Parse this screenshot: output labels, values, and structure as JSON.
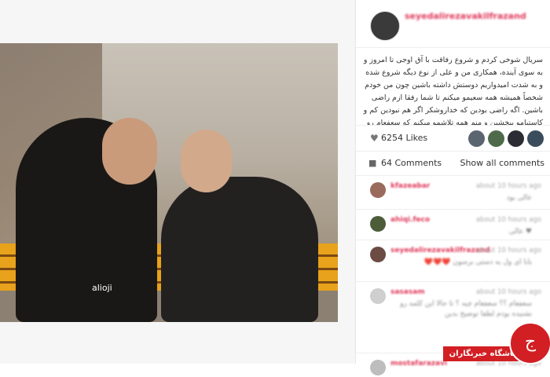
{
  "post": {
    "username": "seyedalirezavakilfrazand",
    "photo_watermark": "alioji",
    "caption": "سریال شوخی کردم و شروع رفاقت با آق اوجی تا امروز و به سوی آینده، همکاری من و علی از نوع دیگه شروع شده و به شدت امیدواریم دوستش داشته باشین چون من خودم شخصاً همیشه همه سعیمو میکنم تا شما رفقا ازم راضی باشین. اگه راضی بودین که خداروشکر اگر هم نبودین کم و کاستیامو ببخشین و منم همه تلاشمو میکنم که سعفعام رو کمتر کنم.مثل همیشه ممنون مهرتونم",
    "likes_label": "6254 Likes",
    "comments_label": "64 Comments",
    "show_all_label": "Show all comments"
  },
  "comments": [
    {
      "user": "kfazeabar",
      "time": "about 10 hours ago",
      "text": "عالی بود"
    },
    {
      "user": "ahiqi.feco",
      "time": "about 10 hours ago",
      "text": "♥ عالی"
    },
    {
      "user": "seyedalirezavakilfrazand",
      "time": "about 10 hours ago",
      "text": "بابا ای ول یه دستی برسون ❤️❤️❤️"
    },
    {
      "user": "sasasam",
      "time": "about 10 hours ago",
      "text": "سعفعام ؟؟ سعفعام چیه ؟ تا حالا این کلمه رو نشنیده بودم لطفا توضیح بدین"
    },
    {
      "user": "mostafarazavi",
      "time": "about 10 hours ago",
      "text": ""
    }
  ],
  "icons": {
    "heart": "heart-icon",
    "comment": "comment-bubble-icon"
  },
  "logo": {
    "label": "باشگاه خبرنگاران",
    "mark": "ج"
  },
  "colors": {
    "accent": "#e0395a",
    "logo_red": "#d21f24"
  }
}
